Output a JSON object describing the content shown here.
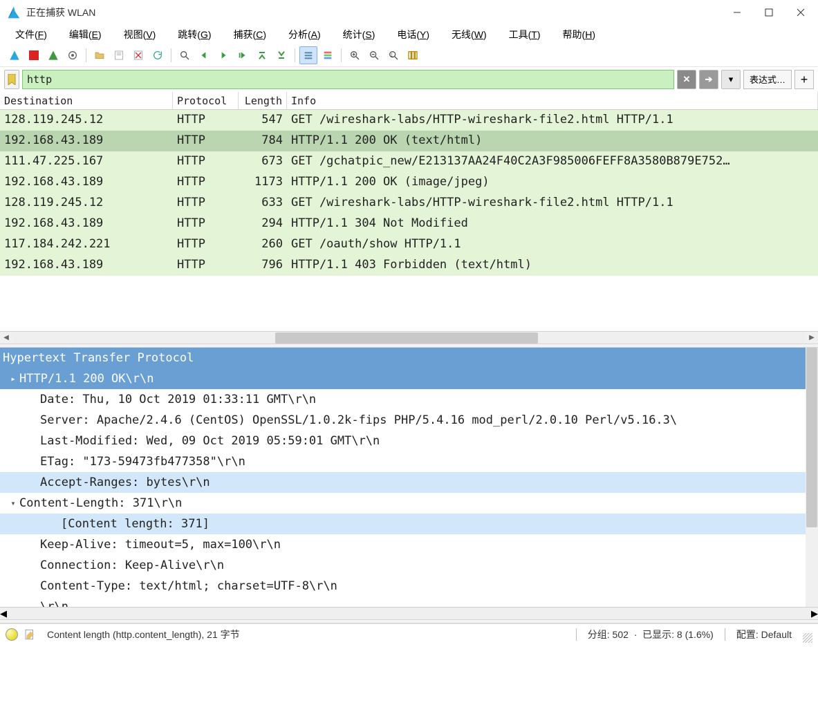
{
  "titlebar": {
    "title": "正在捕获 WLAN"
  },
  "menu": {
    "items": [
      {
        "label": "文件",
        "key": "F"
      },
      {
        "label": "编辑",
        "key": "E"
      },
      {
        "label": "视图",
        "key": "V"
      },
      {
        "label": "跳转",
        "key": "G"
      },
      {
        "label": "捕获",
        "key": "C"
      },
      {
        "label": "分析",
        "key": "A"
      },
      {
        "label": "统计",
        "key": "S"
      },
      {
        "label": "电话",
        "key": "Y"
      },
      {
        "label": "无线",
        "key": "W"
      },
      {
        "label": "工具",
        "key": "T"
      },
      {
        "label": "帮助",
        "key": "H"
      }
    ]
  },
  "filter": {
    "value": "http",
    "expression_label": "表达式…",
    "clear": "✕",
    "apply": "→"
  },
  "columns": {
    "destination": "Destination",
    "protocol": "Protocol",
    "length": "Length",
    "info": "Info"
  },
  "packets": [
    {
      "dest": "128.119.245.12",
      "proto": "HTTP",
      "len": "547",
      "info": "GET /wireshark-labs/HTTP-wireshark-file2.html HTTP/1.1",
      "sel": false
    },
    {
      "dest": "192.168.43.189",
      "proto": "HTTP",
      "len": "784",
      "info": "HTTP/1.1 200 OK  (text/html)",
      "sel": true
    },
    {
      "dest": "111.47.225.167",
      "proto": "HTTP",
      "len": "673",
      "info": "GET /gchatpic_new/E213137AA24F40C2A3F985006FEFF8A3580B879E752…",
      "sel": false
    },
    {
      "dest": "192.168.43.189",
      "proto": "HTTP",
      "len": "1173",
      "info": "HTTP/1.1 200 OK  (image/jpeg)",
      "sel": false
    },
    {
      "dest": "128.119.245.12",
      "proto": "HTTP",
      "len": "633",
      "info": "GET /wireshark-labs/HTTP-wireshark-file2.html HTTP/1.1",
      "sel": false
    },
    {
      "dest": "192.168.43.189",
      "proto": "HTTP",
      "len": "294",
      "info": "HTTP/1.1 304 Not Modified",
      "sel": false
    },
    {
      "dest": "117.184.242.221",
      "proto": "HTTP",
      "len": "260",
      "info": "GET /oauth/show HTTP/1.1",
      "sel": false
    },
    {
      "dest": "192.168.43.189",
      "proto": "HTTP",
      "len": "796",
      "info": "HTTP/1.1 403 Forbidden  (text/html)",
      "sel": false
    }
  ],
  "details": {
    "root": "Hypertext Transfer Protocol",
    "status_line": "HTTP/1.1 200 OK\\r\\n",
    "lines": {
      "date": "Date: Thu, 10 Oct 2019 01:33:11 GMT\\r\\n",
      "server": "Server: Apache/2.4.6 (CentOS) OpenSSL/1.0.2k-fips PHP/5.4.16 mod_perl/2.0.10 Perl/v5.16.3\\",
      "lastmod": "Last-Modified: Wed, 09 Oct 2019 05:59:01 GMT\\r\\n",
      "etag": "ETag: \"173-59473fb477358\"\\r\\n",
      "accept": "Accept-Ranges: bytes\\r\\n",
      "clen": "Content-Length: 371\\r\\n",
      "clen_child": "[Content length: 371]",
      "keepalive": "Keep-Alive: timeout=5, max=100\\r\\n",
      "connection": "Connection: Keep-Alive\\r\\n",
      "ctype": "Content-Type: text/html; charset=UTF-8\\r\\n",
      "crlf": "\\r\\n"
    }
  },
  "status": {
    "field": "Content length (http.content_length), 21 字节",
    "packets": "分组: 502",
    "displayed": "已显示: 8 (1.6%)",
    "profile": "配置: Default"
  }
}
